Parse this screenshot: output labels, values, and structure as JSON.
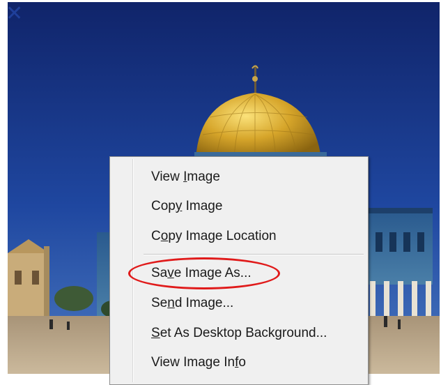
{
  "close_button": {
    "icon": "close-icon",
    "glyph": "✕"
  },
  "photo": {
    "sky_color": "#1c3a8a",
    "dome_color": "#d4a52c",
    "ground_color": "#b8a488"
  },
  "context_menu": {
    "items": [
      {
        "label_pre": "View ",
        "label_mnemonic": "I",
        "label_post": "mage"
      },
      {
        "label_pre": "Cop",
        "label_mnemonic": "y",
        "label_post": " Image"
      },
      {
        "label_pre": "C",
        "label_mnemonic": "o",
        "label_post": "py Image Location"
      },
      {
        "label_pre": "Sa",
        "label_mnemonic": "v",
        "label_post": "e Image As..."
      },
      {
        "label_pre": "Se",
        "label_mnemonic": "n",
        "label_post": "d Image..."
      },
      {
        "label_pre": "",
        "label_mnemonic": "S",
        "label_post": "et As Desktop Background..."
      },
      {
        "label_pre": "View Image In",
        "label_mnemonic": "f",
        "label_post": "o"
      }
    ]
  },
  "annotation": {
    "color": "#e01a1a"
  }
}
